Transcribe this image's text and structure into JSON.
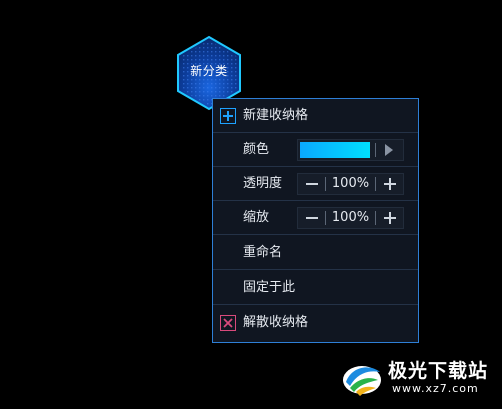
{
  "category_badge": {
    "label": "新分类",
    "colors": {
      "border": "#20c8ff",
      "fill": "#0a3fa8"
    }
  },
  "menu": {
    "new_box": {
      "label": "新建收纳格",
      "icon": "plus-icon"
    },
    "color": {
      "label": "颜色",
      "value": "#0aa8ff",
      "arrow_icon": "play-arrow-icon"
    },
    "opacity": {
      "label": "透明度",
      "value": "100%"
    },
    "zoom": {
      "label": "缩放",
      "value": "100%"
    },
    "rename": {
      "label": "重命名"
    },
    "pin_here": {
      "label": "固定于此"
    },
    "dissolve": {
      "label": "解散收纳格",
      "icon": "close-icon"
    }
  },
  "watermark": {
    "name": "极光下载站",
    "url": "www.xz7.com"
  },
  "colors": {
    "menu_border": "#2e7fd6",
    "menu_bg": "#101621",
    "accent": "#1ea2ff",
    "danger": "#d84a7c"
  }
}
